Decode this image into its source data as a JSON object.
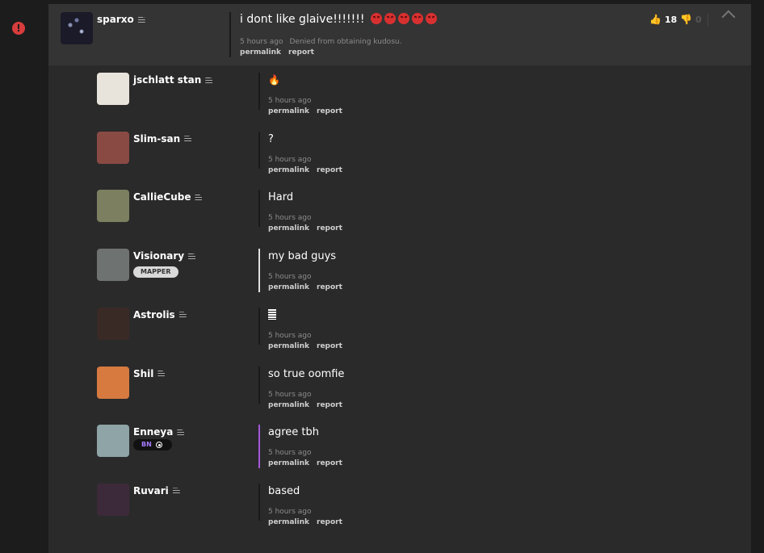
{
  "main_post": {
    "username": "sparxo",
    "message": "i dont like glaive!!!!!!!",
    "emoji_count": 5,
    "time": "5 hours ago",
    "status": "Denied from obtaining kudosu.",
    "actions": [
      "permalink",
      "report"
    ],
    "upvotes": "18",
    "downvotes": "0"
  },
  "replies": [
    {
      "username": "jschlatt stan",
      "message": "🔥",
      "time": "5 hours ago",
      "badge": null,
      "avatar_color": "#e8e4dc"
    },
    {
      "username": "Slim-san",
      "message": "?",
      "time": "5 hours ago",
      "badge": null,
      "avatar_color": "#8a4a44"
    },
    {
      "username": "CallieCube",
      "message": "Hard",
      "time": "5 hours ago",
      "badge": null,
      "avatar_color": "#7c8060"
    },
    {
      "username": "Visionary",
      "message": "my bad guys",
      "time": "5 hours ago",
      "badge": "MAPPER",
      "avatar_color": "#6e7270"
    },
    {
      "username": "Astrolis",
      "message": "",
      "time": "5 hours ago",
      "badge": null,
      "avatar_color": "#3a2a26"
    },
    {
      "username": "Shil",
      "message": "so true oomfie",
      "time": "5 hours ago",
      "badge": null,
      "avatar_color": "#d67a40"
    },
    {
      "username": "Enneya",
      "message": "agree tbh",
      "time": "5 hours ago",
      "badge": "BN",
      "avatar_color": "#8ea4a6"
    },
    {
      "username": "Ruvari",
      "message": "based",
      "time": "5 hours ago",
      "badge": null,
      "avatar_color": "#3c2a3a"
    }
  ],
  "actions": {
    "permalink": "permalink",
    "report": "report"
  },
  "colors": {
    "accent_mapper_line": "#e0e0e0",
    "accent_bn_line": "#a457d8",
    "vote_up": "#7ec850",
    "alert": "#d83c3c"
  }
}
